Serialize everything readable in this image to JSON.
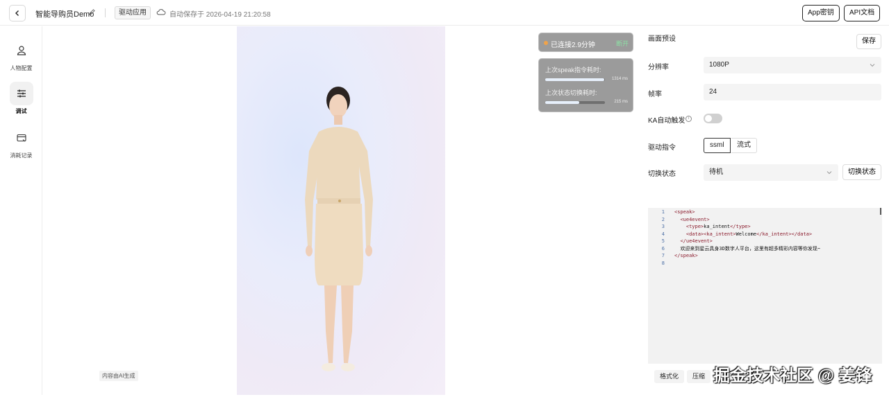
{
  "topbar": {
    "app_name": "智能导购员Demo",
    "drive_app": "驱动应用",
    "autosave": "自动保存于 2026-04-19 21:20:58",
    "app_secret": "App密钥",
    "api_docs": "API文档"
  },
  "sidebar": {
    "items": [
      {
        "label": "人物配置",
        "icon": "person-icon"
      },
      {
        "label": "调试",
        "icon": "sliders-icon",
        "active": true
      },
      {
        "label": "消耗记录",
        "icon": "card-icon"
      }
    ]
  },
  "canvas": {
    "ai_tag": "内容由AI生成",
    "status": {
      "text": "已连接2.9分钟",
      "action": "断开"
    },
    "latency": {
      "speak_label": "上次speak指令耗时:",
      "speak_value": "1314 ms",
      "speak_ratio": 0.99,
      "switch_label": "上次状态切换耗时:",
      "switch_value": "215 ms",
      "switch_ratio": 0.57
    }
  },
  "panel": {
    "preset_label": "画面预设",
    "save": "保存",
    "resolution_label": "分辨率",
    "resolution_value": "1080P",
    "fps_label": "帧率",
    "fps_value": "24",
    "ka_label": "KA自动触发",
    "ka_enabled": false,
    "command_label": "驱动指令",
    "command_options": [
      "ssml",
      "流式"
    ],
    "command_selected": "ssml",
    "state_label": "切换状态",
    "state_value": "待机",
    "switch_button": "切换状态",
    "format_button": "格式化",
    "compress_button": "压缩"
  },
  "code": {
    "lines": [
      {
        "n": "1",
        "indent": "",
        "open": "<speak>",
        "text": "",
        "close": ""
      },
      {
        "n": "2",
        "indent": "  ",
        "open": "<ue4event>",
        "text": "",
        "close": ""
      },
      {
        "n": "3",
        "indent": "    ",
        "open": "<type>",
        "text": "ka_intent",
        "close": "</type>"
      },
      {
        "n": "4",
        "indent": "    ",
        "open": "<data><ka_intent>",
        "text": "Welcome",
        "close": "</ka_intent></data>"
      },
      {
        "n": "5",
        "indent": "  ",
        "open": "</ue4event>",
        "text": "",
        "close": ""
      },
      {
        "n": "6",
        "indent": "  ",
        "open": "",
        "text": "欢迎来到星云具身3D数字人平台，这里有超多精彩内容等你发现~",
        "close": ""
      },
      {
        "n": "7",
        "indent": "",
        "open": "</speak>",
        "text": "",
        "close": ""
      },
      {
        "n": "8",
        "indent": "",
        "open": "",
        "text": "",
        "close": ""
      }
    ]
  },
  "watermark": "掘金技术社区 @ 姜锋",
  "colors": {
    "accent": "#222222",
    "status_dot": "#f0a34a",
    "status_action": "#8de0a5"
  }
}
